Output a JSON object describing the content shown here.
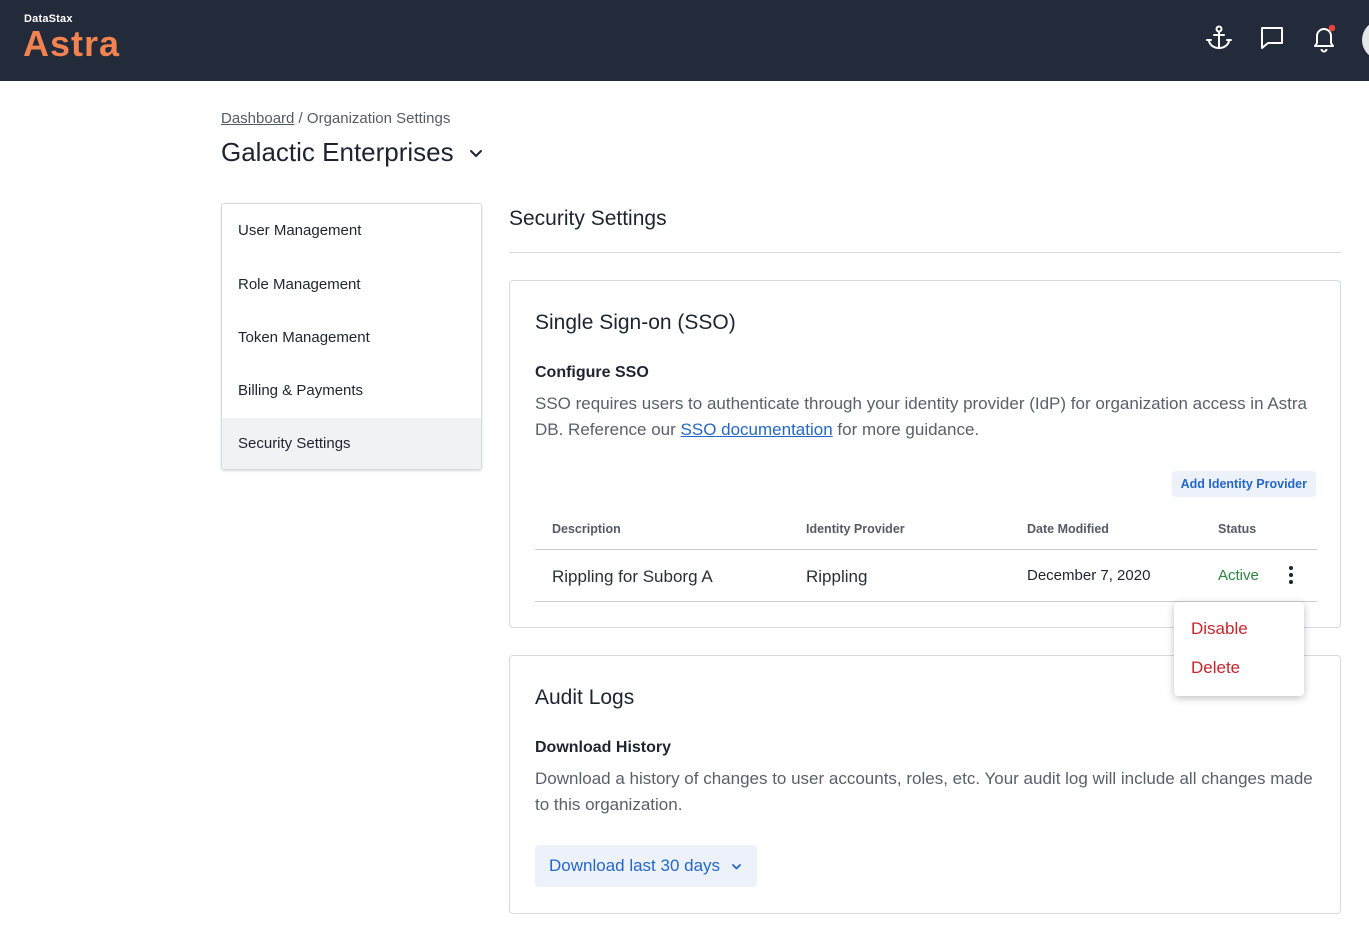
{
  "brand": {
    "company": "DataStax",
    "product": "Astra",
    "accent": "#f0834f"
  },
  "header": {
    "icons": [
      "anchor-icon",
      "chat-icon",
      "bell-icon"
    ],
    "notification_color": "#e8433a"
  },
  "breadcrumb": {
    "home": "Dashboard",
    "separator": " / ",
    "current": "Organization Settings"
  },
  "org": {
    "name": "Galactic Enterprises"
  },
  "sidebar": {
    "items": [
      {
        "label": "User Management"
      },
      {
        "label": "Role Management"
      },
      {
        "label": "Token Management"
      },
      {
        "label": "Billing & Payments"
      },
      {
        "label": "Security Settings",
        "active": true
      }
    ]
  },
  "main": {
    "title": "Security Settings",
    "sso": {
      "title": "Single Sign-on (SSO)",
      "subtitle": "Configure SSO",
      "desc_before": "SSO requires users to authenticate through your identity provider (IdP) for organization access in Astra DB. Reference our ",
      "desc_link": "SSO documentation",
      "desc_after": " for more guidance.",
      "add_button": "Add Identity Provider",
      "columns": [
        "Description",
        "Identity Provider",
        "Date Modified",
        "Status"
      ],
      "rows": [
        {
          "description": "Rippling for Suborg A",
          "provider": "Rippling",
          "date": "December 7, 2020",
          "status": "Active"
        }
      ],
      "menu": [
        "Disable",
        "Delete"
      ]
    },
    "audit": {
      "title": "Audit Logs",
      "subtitle": "Download History",
      "desc": "Download a history of changes to user accounts, roles, etc. Your audit log will include all changes made to this organization.",
      "download_button": "Download last 30 days"
    }
  }
}
